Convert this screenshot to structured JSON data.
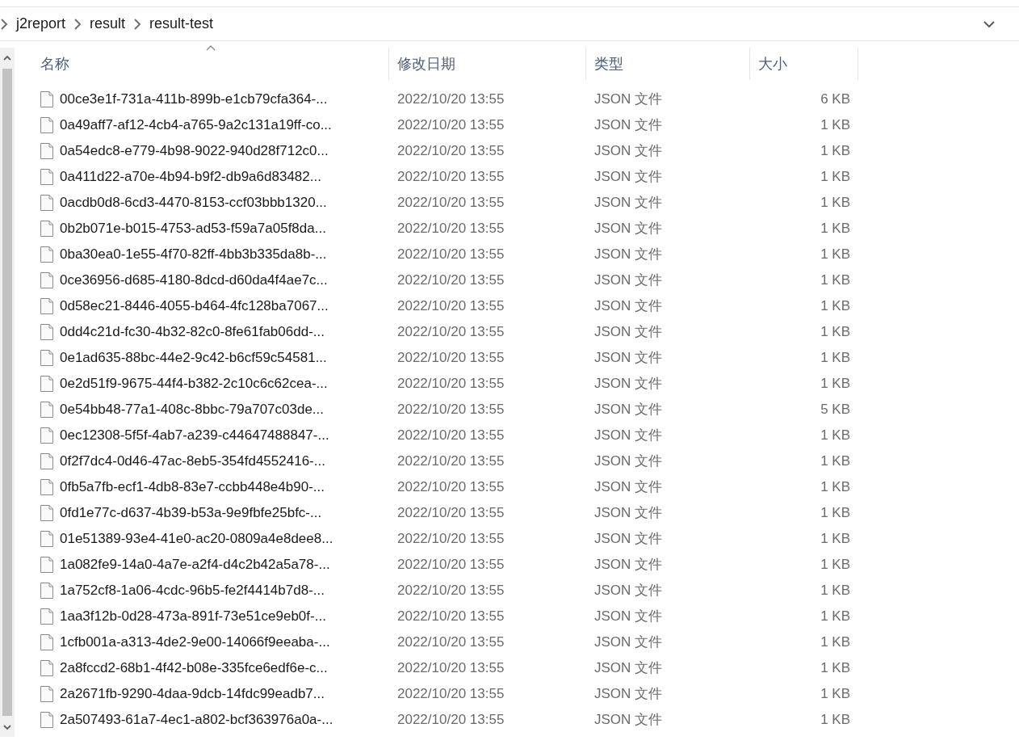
{
  "breadcrumb": [
    "j2report",
    "result",
    "result-test"
  ],
  "columns": [
    {
      "label": "名称",
      "sorted": true
    },
    {
      "label": "修改日期",
      "sorted": false
    },
    {
      "label": "类型",
      "sorted": false
    },
    {
      "label": "大小",
      "sorted": false
    }
  ],
  "files": [
    {
      "name": "00ce3e1f-731a-411b-899b-e1cb79cfa364-...",
      "modified": "2022/10/20 13:55",
      "type": "JSON 文件",
      "size": "6 KB"
    },
    {
      "name": "0a49aff7-af12-4cb4-a765-9a2c131a19ff-co...",
      "modified": "2022/10/20 13:55",
      "type": "JSON 文件",
      "size": "1 KB"
    },
    {
      "name": "0a54edc8-e779-4b98-9022-940d28f712c0...",
      "modified": "2022/10/20 13:55",
      "type": "JSON 文件",
      "size": "1 KB"
    },
    {
      "name": "0a411d22-a70e-4b94-b9f2-db9a6d83482...",
      "modified": "2022/10/20 13:55",
      "type": "JSON 文件",
      "size": "1 KB"
    },
    {
      "name": "0acdb0d8-6cd3-4470-8153-ccf03bbb1320...",
      "modified": "2022/10/20 13:55",
      "type": "JSON 文件",
      "size": "1 KB"
    },
    {
      "name": "0b2b071e-b015-4753-ad53-f59a7a05f8da...",
      "modified": "2022/10/20 13:55",
      "type": "JSON 文件",
      "size": "1 KB"
    },
    {
      "name": "0ba30ea0-1e55-4f70-82ff-4bb3b335da8b-...",
      "modified": "2022/10/20 13:55",
      "type": "JSON 文件",
      "size": "1 KB"
    },
    {
      "name": "0ce36956-d685-4180-8dcd-d60da4f4ae7c...",
      "modified": "2022/10/20 13:55",
      "type": "JSON 文件",
      "size": "1 KB"
    },
    {
      "name": "0d58ec21-8446-4055-b464-4fc128ba7067...",
      "modified": "2022/10/20 13:55",
      "type": "JSON 文件",
      "size": "1 KB"
    },
    {
      "name": "0dd4c21d-fc30-4b32-82c0-8fe61fab06dd-...",
      "modified": "2022/10/20 13:55",
      "type": "JSON 文件",
      "size": "1 KB"
    },
    {
      "name": "0e1ad635-88bc-44e2-9c42-b6cf59c54581...",
      "modified": "2022/10/20 13:55",
      "type": "JSON 文件",
      "size": "1 KB"
    },
    {
      "name": "0e2d51f9-9675-44f4-b382-2c10c6c62cea-...",
      "modified": "2022/10/20 13:55",
      "type": "JSON 文件",
      "size": "1 KB"
    },
    {
      "name": "0e54bb48-77a1-408c-8bbc-79a707c03de...",
      "modified": "2022/10/20 13:55",
      "type": "JSON 文件",
      "size": "5 KB"
    },
    {
      "name": "0ec12308-5f5f-4ab7-a239-c44647488847-...",
      "modified": "2022/10/20 13:55",
      "type": "JSON 文件",
      "size": "1 KB"
    },
    {
      "name": "0f2f7dc4-0d46-47ac-8eb5-354fd4552416-...",
      "modified": "2022/10/20 13:55",
      "type": "JSON 文件",
      "size": "1 KB"
    },
    {
      "name": "0fb5a7fb-ecf1-4db8-83e7-ccbb448e4b90-...",
      "modified": "2022/10/20 13:55",
      "type": "JSON 文件",
      "size": "1 KB"
    },
    {
      "name": "0fd1e77c-d637-4b39-b53a-9e9fbfe25bfc-...",
      "modified": "2022/10/20 13:55",
      "type": "JSON 文件",
      "size": "1 KB"
    },
    {
      "name": "01e51389-93e4-41e0-ac20-0809a4e8dee8...",
      "modified": "2022/10/20 13:55",
      "type": "JSON 文件",
      "size": "1 KB"
    },
    {
      "name": "1a082fe9-14a0-4a7e-a2f4-d4c2b42a5a78-...",
      "modified": "2022/10/20 13:55",
      "type": "JSON 文件",
      "size": "1 KB"
    },
    {
      "name": "1a752cf8-1a06-4cdc-96b5-fe2f4414b7d8-...",
      "modified": "2022/10/20 13:55",
      "type": "JSON 文件",
      "size": "1 KB"
    },
    {
      "name": "1aa3f12b-0d28-473a-891f-73e51ce9eb0f-...",
      "modified": "2022/10/20 13:55",
      "type": "JSON 文件",
      "size": "1 KB"
    },
    {
      "name": "1cfb001a-a313-4de2-9e00-14066f9eeaba-...",
      "modified": "2022/10/20 13:55",
      "type": "JSON 文件",
      "size": "1 KB"
    },
    {
      "name": "2a8fccd2-68b1-4f42-b08e-335fce6edf6e-c...",
      "modified": "2022/10/20 13:55",
      "type": "JSON 文件",
      "size": "1 KB"
    },
    {
      "name": "2a2671fb-9290-4daa-9dcb-14fdc99eadb7...",
      "modified": "2022/10/20 13:55",
      "type": "JSON 文件",
      "size": "1 KB"
    },
    {
      "name": "2a507493-61a7-4ec1-a802-bcf363976a0a-...",
      "modified": "2022/10/20 13:55",
      "type": "JSON 文件",
      "size": "1 KB"
    }
  ]
}
